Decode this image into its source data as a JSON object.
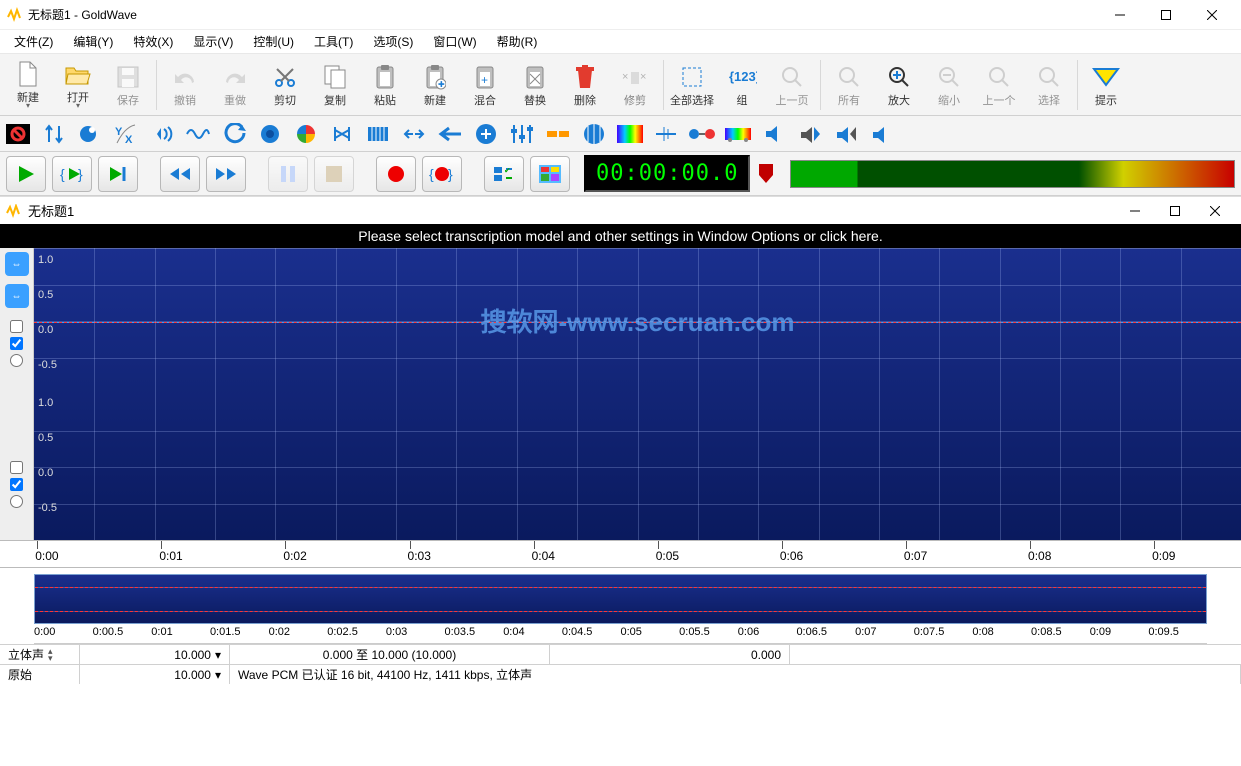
{
  "window": {
    "title": "无标题1 - GoldWave"
  },
  "menu": [
    "文件(Z)",
    "编辑(Y)",
    "特效(X)",
    "显示(V)",
    "控制(U)",
    "工具(T)",
    "选项(S)",
    "窗口(W)",
    "帮助(R)"
  ],
  "toolbar": {
    "new": "新建",
    "open": "打开",
    "save": "保存",
    "undo": "撤销",
    "redo": "重做",
    "cut": "剪切",
    "copy": "复制",
    "paste": "粘贴",
    "paste_new": "新建",
    "mix": "混合",
    "replace": "替换",
    "delete": "删除",
    "trim": "修剪",
    "select_all": "全部选择",
    "group": "组",
    "prev": "上一页",
    "all": "所有",
    "zoom_in": "放大",
    "zoom_out": "缩小",
    "prev2": "上一个",
    "select": "选择",
    "hint": "提示"
  },
  "transport": {
    "time": "00:00:00.0"
  },
  "doc": {
    "title": "无标题1"
  },
  "banner": "Please select transcription model and other settings in Window Options or click here.",
  "watermark": "搜软网-www.secruan.com",
  "amp_labels_top": [
    "1.0",
    "0.5",
    "0.0",
    "-0.5"
  ],
  "amp_labels_bot": [
    "1.0",
    "0.5",
    "0.0",
    "-0.5"
  ],
  "ruler": [
    "0:00",
    "0:01",
    "0:02",
    "0:03",
    "0:04",
    "0:05",
    "0:06",
    "0:07",
    "0:08",
    "0:09"
  ],
  "ov_ruler": [
    "0:00",
    "0:00.5",
    "0:01",
    "0:01.5",
    "0:02",
    "0:02.5",
    "0:03",
    "0:03.5",
    "0:04",
    "0:04.5",
    "0:05",
    "0:05.5",
    "0:06",
    "0:06.5",
    "0:07",
    "0:07.5",
    "0:08",
    "0:08.5",
    "0:09",
    "0:09.5"
  ],
  "status1": {
    "channels": "立体声",
    "col2": "10.000",
    "range": "0.000 至 10.000 (10.000)",
    "col4": "0.000"
  },
  "status2": {
    "format": "原始",
    "col2": "10.000",
    "desc": "Wave PCM 已认证 16 bit, 44100 Hz, 1411 kbps, 立体声"
  }
}
